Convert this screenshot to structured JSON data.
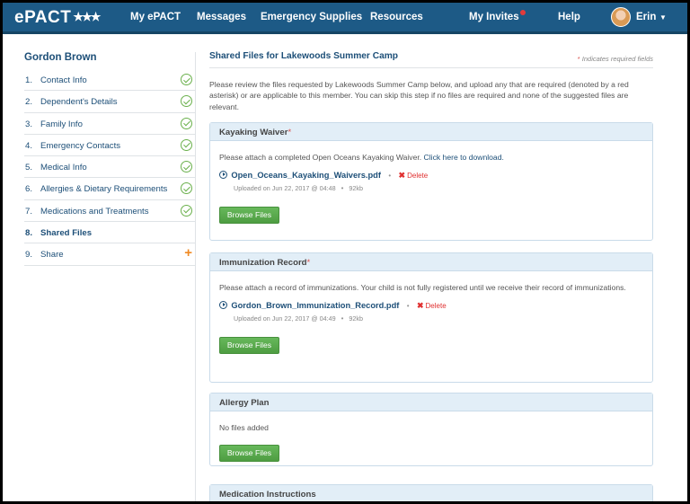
{
  "header": {
    "logo": "ePACT",
    "nav": [
      "My ePACT",
      "Messages",
      "Emergency Supplies",
      "Resources",
      "My Invites",
      "Help"
    ],
    "user_name": "Erin",
    "accent": "#1d5a86"
  },
  "sidebar": {
    "title": "Gordon Brown",
    "items": [
      {
        "num": "1.",
        "label": "Contact Info",
        "status": "complete"
      },
      {
        "num": "2.",
        "label": "Dependent's Details",
        "status": "complete"
      },
      {
        "num": "3.",
        "label": "Family Info",
        "status": "complete"
      },
      {
        "num": "4.",
        "label": "Emergency Contacts",
        "status": "complete"
      },
      {
        "num": "5.",
        "label": "Medical Info",
        "status": "complete"
      },
      {
        "num": "6.",
        "label": "Allergies & Dietary Requirements",
        "status": "complete"
      },
      {
        "num": "7.",
        "label": "Medications and Treatments",
        "status": "complete"
      },
      {
        "num": "8.",
        "label": "Shared Files",
        "status": "active"
      },
      {
        "num": "9.",
        "label": "Share",
        "status": "add"
      }
    ]
  },
  "main": {
    "title": "Shared Files for Lakewoods Summer Camp",
    "required_note_star": "*",
    "required_note": " Indicates required fields",
    "intro": "Please review the files requested by Lakewoods Summer Camp below, and upload any that are required (denoted by a red asterisk) or are applicable to this member. You can skip this step if no files are required and none of the suggested files are relevant.",
    "browse_label": "Browse Files",
    "delete_label": "Delete",
    "sections": [
      {
        "title": "Kayaking Waiver",
        "required": "*",
        "instruction": "Please attach a completed Open Oceans Kayaking Waiver.",
        "link": "Click here to download.",
        "file_name": "Open_Oceans_Kayaking_Waivers.pdf",
        "uploaded": "Uploaded on Jun 22, 2017 @ 04:48",
        "size": "92kb"
      },
      {
        "title": "Immunization Record",
        "required": "*",
        "instruction": "Please attach a record of immunizations. Your child is not fully registered until we receive their record of immunizations.",
        "file_name": "Gordon_Brown_Immunization_Record.pdf",
        "uploaded": "Uploaded on Jun 22, 2017 @ 04:49",
        "size": "92kb"
      },
      {
        "title": "Allergy Plan",
        "empty_text": "No files added"
      },
      {
        "title": "Medication Instructions"
      }
    ]
  }
}
